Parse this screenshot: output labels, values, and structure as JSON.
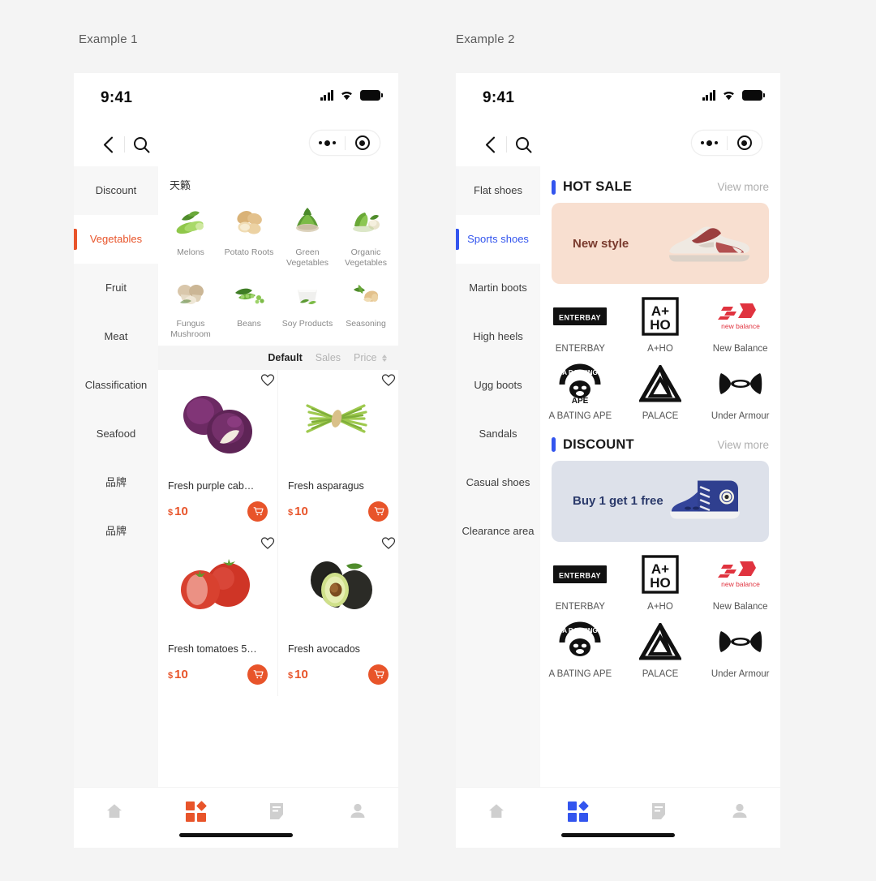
{
  "labels": {
    "example1": "Example 1",
    "example2": "Example 2"
  },
  "colors": {
    "accent_orange": "#e8542a",
    "accent_blue": "#3355ee",
    "page_bg": "#f4f4f4"
  },
  "statusbar": {
    "time": "9:41",
    "signal_icon": "signal-bars-icon",
    "wifi_icon": "wifi-icon",
    "battery_icon": "battery-icon"
  },
  "navbar": {
    "back_icon": "back-chevron-icon",
    "search_icon": "search-icon",
    "more_icon": "more-dots-icon",
    "target_icon": "target-circle-icon"
  },
  "example1": {
    "sidebar": [
      {
        "label": "Discount",
        "active": false
      },
      {
        "label": "Vegetables",
        "active": true
      },
      {
        "label": "Fruit",
        "active": false
      },
      {
        "label": "Meat",
        "active": false
      },
      {
        "label": "Classification",
        "active": false
      },
      {
        "label": "Seafood",
        "active": false
      },
      {
        "label": "品牌",
        "active": false
      },
      {
        "label": "品牌",
        "active": false
      }
    ],
    "category_header": "天籁",
    "categories": [
      {
        "label": "Melons",
        "icon": "melons-icon"
      },
      {
        "label": "Potato Roots",
        "icon": "potato-roots-icon"
      },
      {
        "label": "Green Vegetables",
        "icon": "green-vegetables-icon"
      },
      {
        "label": "Organic Vegetables",
        "icon": "organic-vegetables-icon"
      },
      {
        "label": "Fungus Mushroom",
        "icon": "fungus-mushroom-icon"
      },
      {
        "label": "Beans",
        "icon": "beans-icon"
      },
      {
        "label": "Soy Products",
        "icon": "soy-products-icon"
      },
      {
        "label": "Seasoning",
        "icon": "seasoning-icon"
      }
    ],
    "sort": [
      {
        "label": "Default",
        "active": true,
        "caret": false
      },
      {
        "label": "Sales",
        "active": false,
        "caret": false
      },
      {
        "label": "Price",
        "active": false,
        "caret": true
      }
    ],
    "products": [
      {
        "name": "Fresh purple cab…",
        "currency": "$",
        "price": "10",
        "image": "purple-cabbage-image"
      },
      {
        "name": "Fresh asparagus",
        "currency": "$",
        "price": "10",
        "image": "asparagus-image"
      },
      {
        "name": "Fresh tomatoes 5…",
        "currency": "$",
        "price": "10",
        "image": "tomatoes-image"
      },
      {
        "name": "Fresh avocados",
        "currency": "$",
        "price": "10",
        "image": "avocados-image"
      }
    ],
    "tabs": [
      {
        "icon": "home-icon",
        "active": false
      },
      {
        "icon": "category-grid-icon",
        "active": true
      },
      {
        "icon": "orders-document-icon",
        "active": false
      },
      {
        "icon": "profile-person-icon",
        "active": false
      }
    ]
  },
  "example2": {
    "sidebar": [
      {
        "label": "Flat shoes",
        "active": false
      },
      {
        "label": "Sports shoes",
        "active": true
      },
      {
        "label": "Martin boots",
        "active": false
      },
      {
        "label": "High heels",
        "active": false
      },
      {
        "label": "Ugg boots",
        "active": false
      },
      {
        "label": "Sandals",
        "active": false
      },
      {
        "label": "Casual shoes",
        "active": false
      },
      {
        "label": "Clearance area",
        "active": false
      }
    ],
    "sections": [
      {
        "title": "HOT SALE",
        "more": "View more",
        "banner": {
          "text": "New style",
          "image": "running-shoe-image"
        },
        "brands": [
          {
            "name": "ENTERBAY",
            "logo": "enterbay-logo"
          },
          {
            "name": "A+HO",
            "logo": "a-plus-ho-logo"
          },
          {
            "name": "New Balance",
            "logo": "new-balance-logo"
          },
          {
            "name": "A BATING APE",
            "logo": "bathing-ape-logo"
          },
          {
            "name": "PALACE",
            "logo": "palace-logo"
          },
          {
            "name": "Under Armour",
            "logo": "under-armour-logo"
          }
        ]
      },
      {
        "title": "DISCOUNT",
        "more": "View more",
        "banner": {
          "text": "Buy 1 get 1 free",
          "image": "blue-high-top-sneaker-image"
        },
        "brands": [
          {
            "name": "ENTERBAY",
            "logo": "enterbay-logo"
          },
          {
            "name": "A+HO",
            "logo": "a-plus-ho-logo"
          },
          {
            "name": "New Balance",
            "logo": "new-balance-logo"
          },
          {
            "name": "A BATING APE",
            "logo": "bathing-ape-logo"
          },
          {
            "name": "PALACE",
            "logo": "palace-logo"
          },
          {
            "name": "Under Armour",
            "logo": "under-armour-logo"
          }
        ]
      }
    ],
    "tabs": [
      {
        "icon": "home-icon",
        "active": false
      },
      {
        "icon": "category-grid-icon",
        "active": true
      },
      {
        "icon": "orders-document-icon",
        "active": false
      },
      {
        "icon": "profile-person-icon",
        "active": false
      }
    ]
  }
}
